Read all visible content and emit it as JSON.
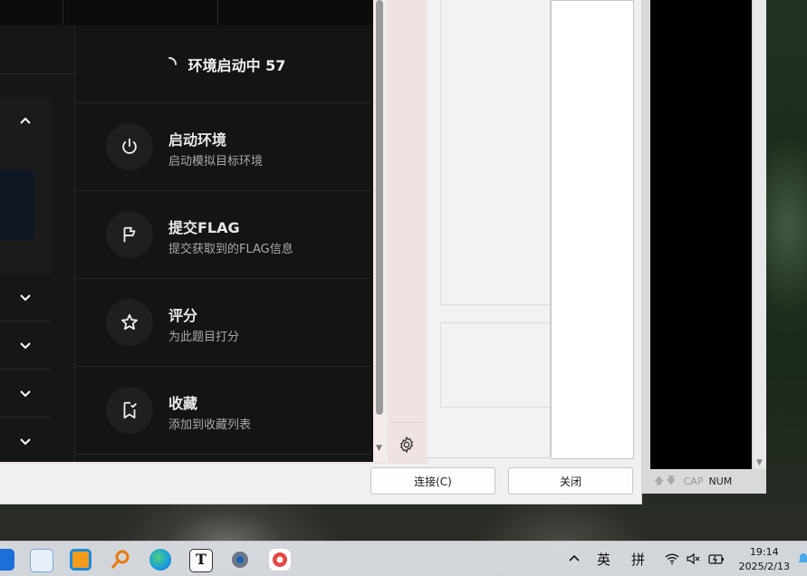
{
  "app_panel": {
    "status": {
      "text": "环境启动中 57"
    },
    "actions": [
      {
        "icon": "power-icon",
        "title": "启动环境",
        "subtitle": "启动模拟目标环境"
      },
      {
        "icon": "flag-icon",
        "title": "提交FLAG",
        "subtitle": "提交获取到的FLAG信息"
      },
      {
        "icon": "star-icon",
        "title": "评分",
        "subtitle": "为此题目打分"
      },
      {
        "icon": "bookmark-check-icon",
        "title": "收藏",
        "subtitle": "添加到收藏列表"
      }
    ]
  },
  "dialog": {
    "connect_label": "连接(C)",
    "close_label": "关闭"
  },
  "terminal": {
    "status_cap": "CAP",
    "status_num": "NUM"
  },
  "taskbar": {
    "apps": [
      "file-explorer-icon",
      "notepad-icon",
      "app-icon",
      "search-app-icon",
      "edge-icon",
      "typora-icon",
      "settings-icon",
      "browser-icon"
    ],
    "tray": {
      "ime_lang": "英",
      "ime_mode": "拼"
    },
    "time": "19:14",
    "date": "2025/2/13"
  },
  "colors": {
    "app_bg": "#121212",
    "accent_pink": "#efe3e1",
    "taskbar_bg": "#dadee2"
  }
}
